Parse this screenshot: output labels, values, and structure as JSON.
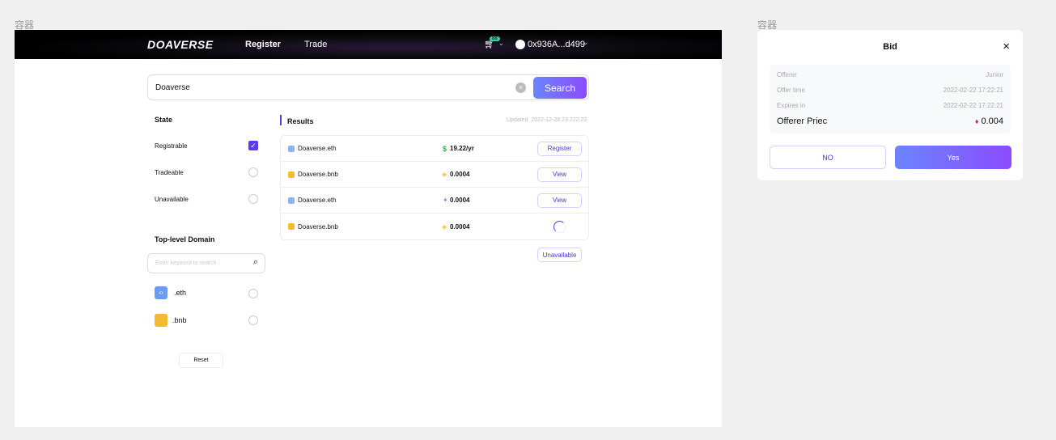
{
  "labels": {
    "left": "容器",
    "right": "容器"
  },
  "nav": {
    "logo": "DOAVERSE",
    "items": [
      "Register",
      "Trade"
    ],
    "cart_badge": "88",
    "account": "0x936A...d499"
  },
  "search": {
    "value": "Doaverse",
    "button": "Search"
  },
  "state": {
    "title": "State",
    "options": [
      {
        "label": "Registrable",
        "checked": true
      },
      {
        "label": "Tradeable",
        "checked": false
      },
      {
        "label": "Unavailable",
        "checked": false
      }
    ]
  },
  "tld": {
    "title": "Top-level Domain",
    "placeholder": "Enter keyword to search",
    "items": [
      {
        "label": ".eth",
        "checked": false
      },
      {
        "label": ".bnb",
        "checked": false
      }
    ],
    "reset": "Reset"
  },
  "results": {
    "title": "Results",
    "updated_label": "Updated",
    "updated": "2022-12-28 23:222:22",
    "rows": [
      {
        "name": "Doaverse.eth",
        "price": "19.22/yr",
        "currency": "dollar",
        "action": "Register"
      },
      {
        "name": "Doaverse.bnb",
        "price": "0.0004",
        "currency": "bnb",
        "action": "View"
      },
      {
        "name": "Doaverse.eth",
        "price": "0.0004",
        "currency": "eth",
        "action": "View"
      },
      {
        "name": "Doaverse.bnb",
        "price": "0.0004",
        "currency": "bnb",
        "action": "loading"
      }
    ],
    "unavailable": "Unavailable"
  },
  "bid": {
    "title": "Bid",
    "offerer_label": "Offerer",
    "offerer": "Junior",
    "offer_time_label": "Offer time",
    "offer_time": "2022-02-22 17:22:21",
    "expires_label": "Expires in",
    "expires": "2022-02-22 17:22:21",
    "price_label": "Offerer Priec",
    "price": "0.004",
    "no": "NO",
    "yes": "Yes"
  },
  "colors": {
    "accent": "#5b3bea",
    "dollar": "#2fb344",
    "bnb": "#f3ba2f",
    "eth": "#6b8cef"
  }
}
